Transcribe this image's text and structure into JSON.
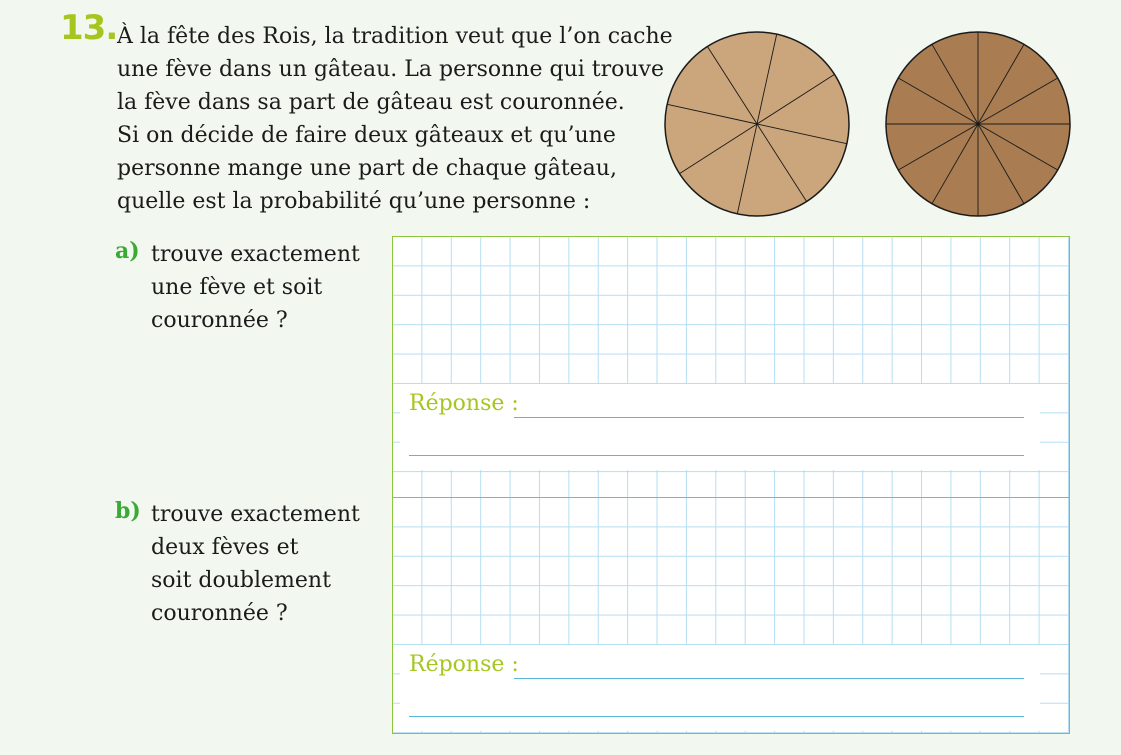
{
  "exercise": {
    "number": "13.",
    "question_lines": [
      "À la fête des Rois, la tradition veut que l’on cache",
      "une fève dans un gâteau. La personne qui trouve",
      "la fève dans sa part de gâteau est couronnée.",
      "Si on décide de faire deux gâteaux et qu’une",
      "personne mange une part de chaque gâteau,",
      "quelle est la probabilité qu’une personne :"
    ]
  },
  "cakes": [
    {
      "slices": 8,
      "fill": "#cba57b"
    },
    {
      "slices": 12,
      "fill": "#a97c52"
    }
  ],
  "parts": {
    "a": {
      "letter": "a)",
      "lines": [
        "trouve exactement",
        "une fève et soit",
        "couronnée ?"
      ],
      "answer_label": "Réponse :"
    },
    "b": {
      "letter": "b)",
      "lines": [
        "trouve exactement",
        "deux fèves et",
        "soit doublement",
        "couronnée ?"
      ],
      "answer_label": "Réponse :"
    }
  },
  "colors": {
    "accent_number": "#a6c61f",
    "part_letter": "#3aaa35",
    "grid": "#b5def2",
    "box_border": "#8cc63f",
    "answer_line": "#58b7dd",
    "page_background": "#f2f8ef"
  }
}
